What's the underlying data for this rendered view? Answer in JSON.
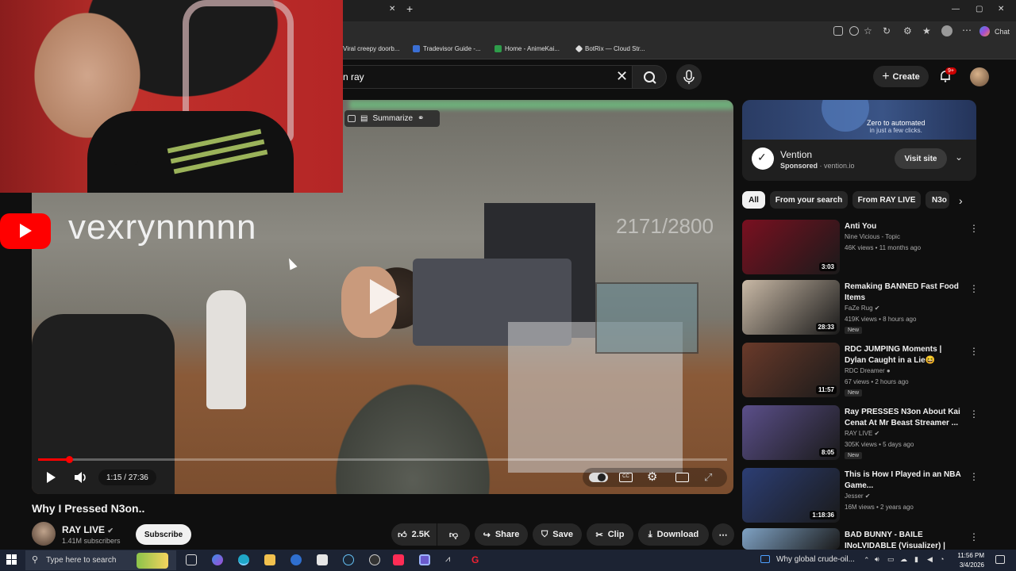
{
  "browser": {
    "bookmarks": [
      {
        "label": "Viral creepy doorb...",
        "color": "#555555"
      },
      {
        "label": "Tradevisor Guide -...",
        "color": "#3b6fd4"
      },
      {
        "label": "Home - AnimeKai...",
        "color": "#2e9c4a"
      },
      {
        "label": "BotRix — Cloud Str...",
        "color": "#dddddd"
      }
    ],
    "chat_label": "Chat"
  },
  "masthead": {
    "search_query": "n ray",
    "create_label": "Create",
    "notifications_badge": "9+"
  },
  "overlay": {
    "streamer_name": "vexrynnnnn",
    "goal_counter": "2171/2800",
    "summarize_label": "Summarize"
  },
  "player": {
    "time_current": "1:15",
    "time_total": "27:36",
    "time_display": "1:15 / 27:36",
    "progress_fraction": 0.045
  },
  "video": {
    "title": "Why I Pressed N3on..",
    "channel_name": "RAY LIVE",
    "channel_subs": "1.41M subscribers",
    "subscribe_label": "Subscribe",
    "likes": "2.5K",
    "share_label": "Share",
    "save_label": "Save",
    "clip_label": "Clip",
    "download_label": "Download"
  },
  "ad": {
    "banner_line1": "Zero to automated",
    "banner_line2": "in just a few clicks.",
    "advertiser": "Vention",
    "sponsored_label": "Sponsored",
    "domain": "vention.io",
    "sponsored_meta": "Sponsored · vention.io",
    "visit_label": "Visit site"
  },
  "chips": [
    "All",
    "From your search",
    "From RAY LIVE",
    "N3o"
  ],
  "recommendations": [
    {
      "title": "Anti You",
      "channel": "Nine Vicious - Topic",
      "views": "46K views • 11 months ago",
      "duration": "3:03",
      "is_new": false,
      "thumb_color": "#7a1020"
    },
    {
      "title": "Remaking BANNED Fast Food Items",
      "channel": "FaZe Rug ✔",
      "views": "419K views • 8 hours ago",
      "duration": "28:33",
      "is_new": true,
      "thumb_color": "#c9b9a6"
    },
    {
      "title": "RDC JUMPING Moments | Dylan Caught in a Lie😆",
      "channel": "RDC Dreamer ●",
      "views": "67 views • 2 hours ago",
      "duration": "11:57",
      "is_new": true,
      "thumb_color": "#6a3a2a"
    },
    {
      "title": "Ray PRESSES N3on About Kai Cenat At Mr Beast Streamer ...",
      "channel": "RAY LIVE ✔",
      "views": "305K views • 5 days ago",
      "duration": "8:05",
      "is_new": true,
      "thumb_color": "#5b4f8a"
    },
    {
      "title": "This is How I Played in an NBA Game...",
      "channel": "Jesser ✔",
      "views": "16M views • 2 years ago",
      "duration": "1:18:36",
      "is_new": false,
      "thumb_color": "#2c3e74"
    },
    {
      "title": "BAD BUNNY - BAILE INoLVIDABLE (Visualizer) | De...",
      "channel": "",
      "views": "",
      "duration": "",
      "is_new": false,
      "thumb_color": "#7fa2c4"
    }
  ],
  "recommendation_new_label": "New",
  "taskbar": {
    "search_placeholder": "Type here to search",
    "news_text": "Why global crude-oil...",
    "time": "11:56 PM",
    "date": "3/4/2026"
  }
}
